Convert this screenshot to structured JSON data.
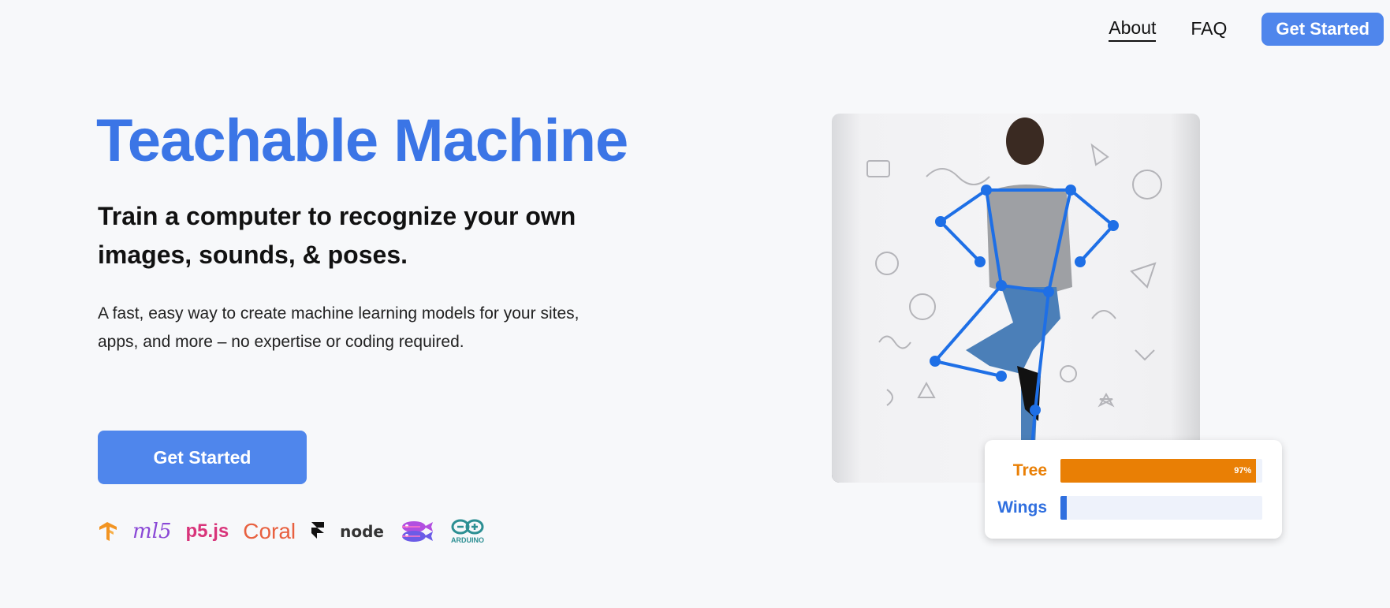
{
  "nav": {
    "about": "About",
    "faq": "FAQ",
    "get_started": "Get Started"
  },
  "hero": {
    "title": "Teachable Machine",
    "subtitle": "Train a computer to recognize your own images, sounds, & poses.",
    "description": "A fast, easy way to create machine learning models for your sites, apps, and more – no expertise or coding required.",
    "cta": "Get Started"
  },
  "logos": {
    "tensorflow": "tensorflow-logo-icon",
    "ml5": "ml5",
    "p5": "p5.js",
    "coral": "Coral",
    "framer": "framer-logo-icon",
    "node": "node",
    "glitch": "glitch-fish-logo-icon",
    "arduino": "ARDUINO"
  },
  "predictions": [
    {
      "label": "Tree",
      "percent": 97,
      "percent_text": "97%",
      "color": "#e97f05"
    },
    {
      "label": "Wings",
      "percent": 3,
      "percent_text": "",
      "color": "#2f6fdf"
    }
  ],
  "colors": {
    "brand_blue": "#3b75e6",
    "button_blue": "#4f86ec",
    "skeleton_blue": "#1e6fe6",
    "tree_orange": "#e97f05",
    "wings_blue": "#2f6fdf"
  }
}
